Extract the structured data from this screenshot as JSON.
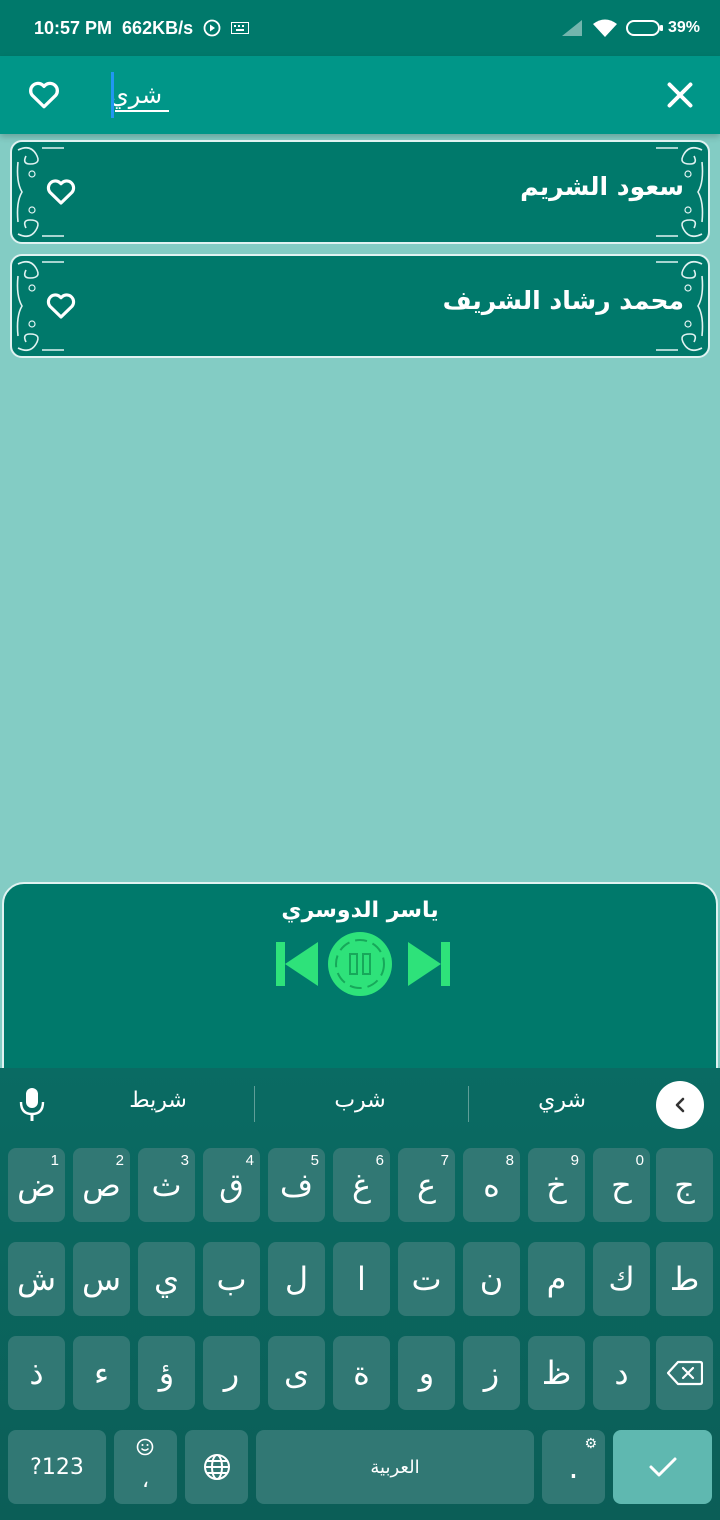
{
  "status": {
    "time": "10:57 PM",
    "speed": "662KB/s",
    "battery": "39%"
  },
  "search": {
    "value": "شري"
  },
  "results": [
    {
      "name": "سعود الشريم"
    },
    {
      "name": "محمد رشاد الشريف"
    }
  ],
  "player": {
    "title": "ياسر الدوسري"
  },
  "keyboard": {
    "suggestions": [
      "شريط",
      "شرب",
      "شري"
    ],
    "row1": [
      {
        "label": "ض",
        "num": "1"
      },
      {
        "label": "ص",
        "num": "2"
      },
      {
        "label": "ث",
        "num": "3"
      },
      {
        "label": "ق",
        "num": "4"
      },
      {
        "label": "ف",
        "num": "5"
      },
      {
        "label": "غ",
        "num": "6"
      },
      {
        "label": "ع",
        "num": "7"
      },
      {
        "label": "ه",
        "num": "8"
      },
      {
        "label": "خ",
        "num": "9"
      },
      {
        "label": "ح",
        "num": "0"
      },
      {
        "label": "ج",
        "num": ""
      }
    ],
    "row2": [
      "ش",
      "س",
      "ي",
      "ب",
      "ل",
      "ا",
      "ت",
      "ن",
      "م",
      "ك",
      "ط"
    ],
    "row3": [
      "ذ",
      "ء",
      "ؤ",
      "ر",
      "ى",
      "ة",
      "و",
      "ز",
      "ظ",
      "د"
    ],
    "row4": {
      "symbols": "?123",
      "comma": "،",
      "space": "العربية",
      "period": "."
    }
  },
  "colors": {
    "primary": "#009688",
    "dark": "#00796b",
    "background": "#83ccc4",
    "accent": "#2ee27a"
  }
}
